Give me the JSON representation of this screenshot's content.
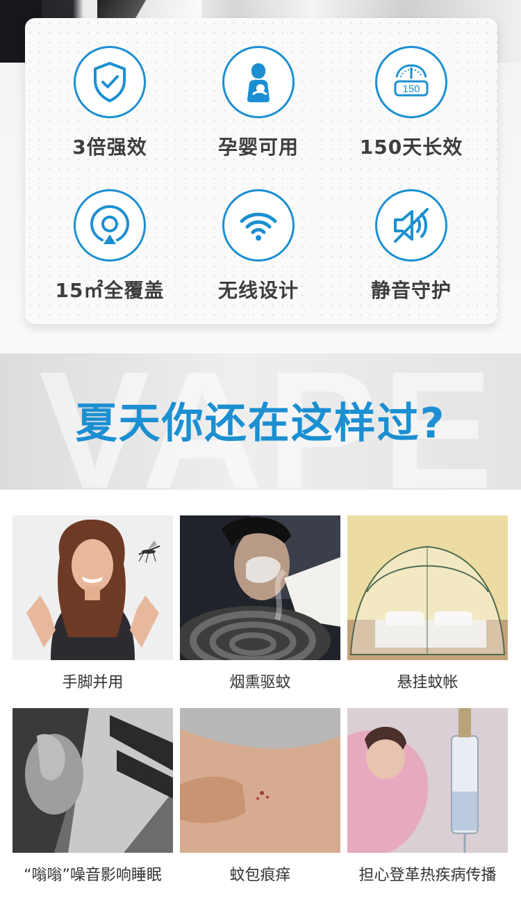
{
  "features": [
    {
      "icon": "shield-check-icon",
      "label": "3倍强效"
    },
    {
      "icon": "mother-baby-icon",
      "label": "孕婴可用"
    },
    {
      "icon": "timer-150-icon",
      "label": "150天长效",
      "icon_text": "150"
    },
    {
      "icon": "coverage-target-icon",
      "label": "15㎡全覆盖"
    },
    {
      "icon": "wifi-icon",
      "label": "无线设计"
    },
    {
      "icon": "mute-speaker-icon",
      "label": "静音守护"
    }
  ],
  "headline": {
    "title": "夏天你还在这样过?",
    "watermark": "VAPE"
  },
  "problems": [
    {
      "caption": "手脚并用"
    },
    {
      "caption": "烟熏驱蚊"
    },
    {
      "caption": "悬挂蚊帐"
    },
    {
      "caption": "“嗡嗡”噪音影响睡眠"
    },
    {
      "caption": "蚊包痕痒"
    },
    {
      "caption": "担心登革热疾病传播"
    }
  ],
  "colors": {
    "accent": "#1b8fd2",
    "label_text": "#3d3d3d",
    "caption_text": "#333333"
  }
}
